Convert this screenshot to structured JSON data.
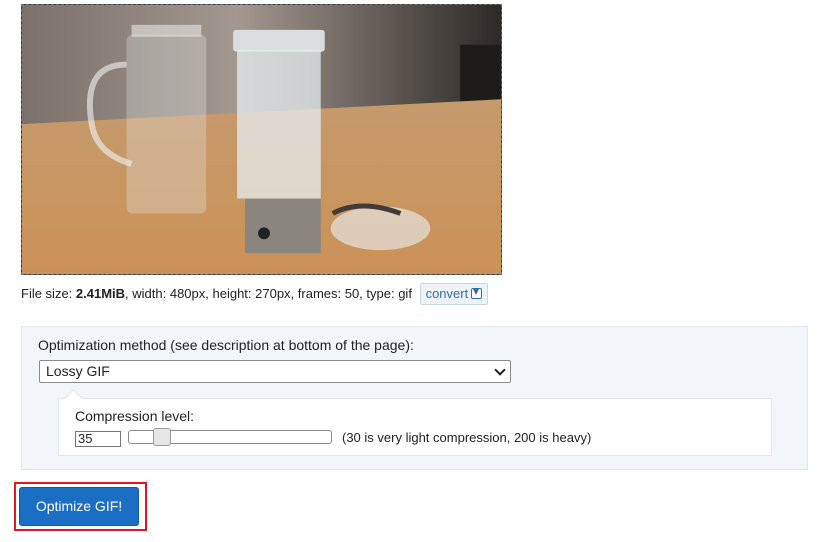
{
  "preview": {
    "alt": "",
    "colors": {
      "background": "#3b3631",
      "table": "#c99760",
      "glass": "#dfe6ea"
    }
  },
  "fileinfo": {
    "prefix": "File size: ",
    "size": "2.41MiB",
    "details": ", width: 480px, height: 270px, frames: 50, type: gif",
    "convert_label": "convert",
    "convert_icon": "download-icon"
  },
  "options": {
    "method_label": "Optimization method (see description at bottom of the page):",
    "method_selected": "Lossy GIF",
    "compression_label": "Compression level:",
    "compression_value": "35",
    "compression_hint": "(30 is very light compression, 200 is heavy)",
    "slider": {
      "min": 30,
      "max": 200,
      "value": 35
    }
  },
  "action": {
    "optimize_label": "Optimize GIF!",
    "accent_color": "#1a6fc4",
    "highlight_color": "#e3161d"
  }
}
